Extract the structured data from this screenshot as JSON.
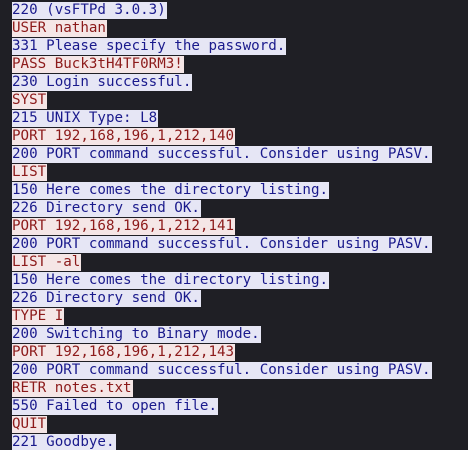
{
  "colors": {
    "background": "#1f1f25",
    "server_bg": "#e6e6f5",
    "server_fg": "#1a1a8c",
    "client_bg": "#f5e6e6",
    "client_fg": "#8c1a1a"
  },
  "stream": [
    {
      "dir": "server",
      "text": "220 (vsFTPd 3.0.3)"
    },
    {
      "dir": "client",
      "text": "USER nathan"
    },
    {
      "dir": "server",
      "text": "331 Please specify the password."
    },
    {
      "dir": "client",
      "text": "PASS Buck3tH4TF0RM3!"
    },
    {
      "dir": "server",
      "text": "230 Login successful."
    },
    {
      "dir": "client",
      "text": "SYST"
    },
    {
      "dir": "server",
      "text": "215 UNIX Type: L8"
    },
    {
      "dir": "client",
      "text": "PORT 192,168,196,1,212,140"
    },
    {
      "dir": "server",
      "text": "200 PORT command successful. Consider using PASV."
    },
    {
      "dir": "client",
      "text": "LIST"
    },
    {
      "dir": "server",
      "text": "150 Here comes the directory listing."
    },
    {
      "dir": "server",
      "text": "226 Directory send OK."
    },
    {
      "dir": "client",
      "text": "PORT 192,168,196,1,212,141"
    },
    {
      "dir": "server",
      "text": "200 PORT command successful. Consider using PASV."
    },
    {
      "dir": "client",
      "text": "LIST -al"
    },
    {
      "dir": "server",
      "text": "150 Here comes the directory listing."
    },
    {
      "dir": "server",
      "text": "226 Directory send OK."
    },
    {
      "dir": "client",
      "text": "TYPE I"
    },
    {
      "dir": "server",
      "text": "200 Switching to Binary mode."
    },
    {
      "dir": "client",
      "text": "PORT 192,168,196,1,212,143"
    },
    {
      "dir": "server",
      "text": "200 PORT command successful. Consider using PASV."
    },
    {
      "dir": "client",
      "text": "RETR notes.txt"
    },
    {
      "dir": "server",
      "text": "550 Failed to open file."
    },
    {
      "dir": "client",
      "text": "QUIT"
    },
    {
      "dir": "server",
      "text": "221 Goodbye."
    }
  ]
}
